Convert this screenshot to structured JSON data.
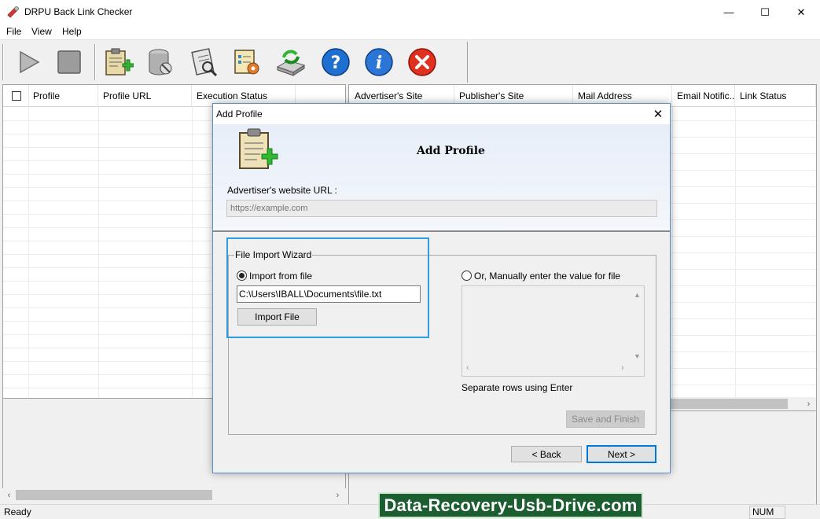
{
  "window": {
    "title": "DRPU Back Link Checker",
    "minimize_glyph": "—",
    "maximize_glyph": "☐",
    "close_glyph": "✕"
  },
  "menu": {
    "items": [
      "File",
      "View",
      "Help"
    ]
  },
  "toolbar": {
    "buttons": [
      {
        "icon": "play-icon"
      },
      {
        "icon": "stop-icon"
      },
      {
        "icon": "add-profile-icon"
      },
      {
        "icon": "database-icon"
      },
      {
        "icon": "report-icon"
      },
      {
        "icon": "settings-icon"
      },
      {
        "icon": "update-icon"
      },
      {
        "icon": "help-icon"
      },
      {
        "icon": "info-icon"
      },
      {
        "icon": "exit-icon"
      }
    ]
  },
  "left_grid": {
    "columns": [
      "Profile",
      "Profile URL",
      "Execution Status"
    ]
  },
  "right_grid": {
    "columns": [
      "Advertiser's Site",
      "Publisher's Site",
      "Mail Address",
      "Email Notific...",
      "Link Status"
    ]
  },
  "status": {
    "text": "Ready",
    "num": "NUM"
  },
  "watermark": "Data-Recovery-Usb-Drive.com",
  "dialog": {
    "title": "Add Profile",
    "heading": "Add Profile",
    "url_label": "Advertiser's website URL :",
    "url_placeholder": "https://example.com",
    "group_label": "File Import Wizard",
    "import_from_file_label": "Import from file",
    "import_from_file_selected": true,
    "file_path": "C:\\Users\\IBALL\\Documents\\file.txt",
    "import_button": "Import File",
    "manual_label": "Or, Manually enter the value for file",
    "manual_selected": false,
    "separate_hint": "Separate rows using Enter",
    "save_finish_button": "Save and Finish",
    "back_button": "< Back",
    "next_button": "Next >"
  },
  "colors": {
    "accent": "#0078d7",
    "highlight": "#2d9be2",
    "watermark_bg": "#1b5e2f"
  }
}
